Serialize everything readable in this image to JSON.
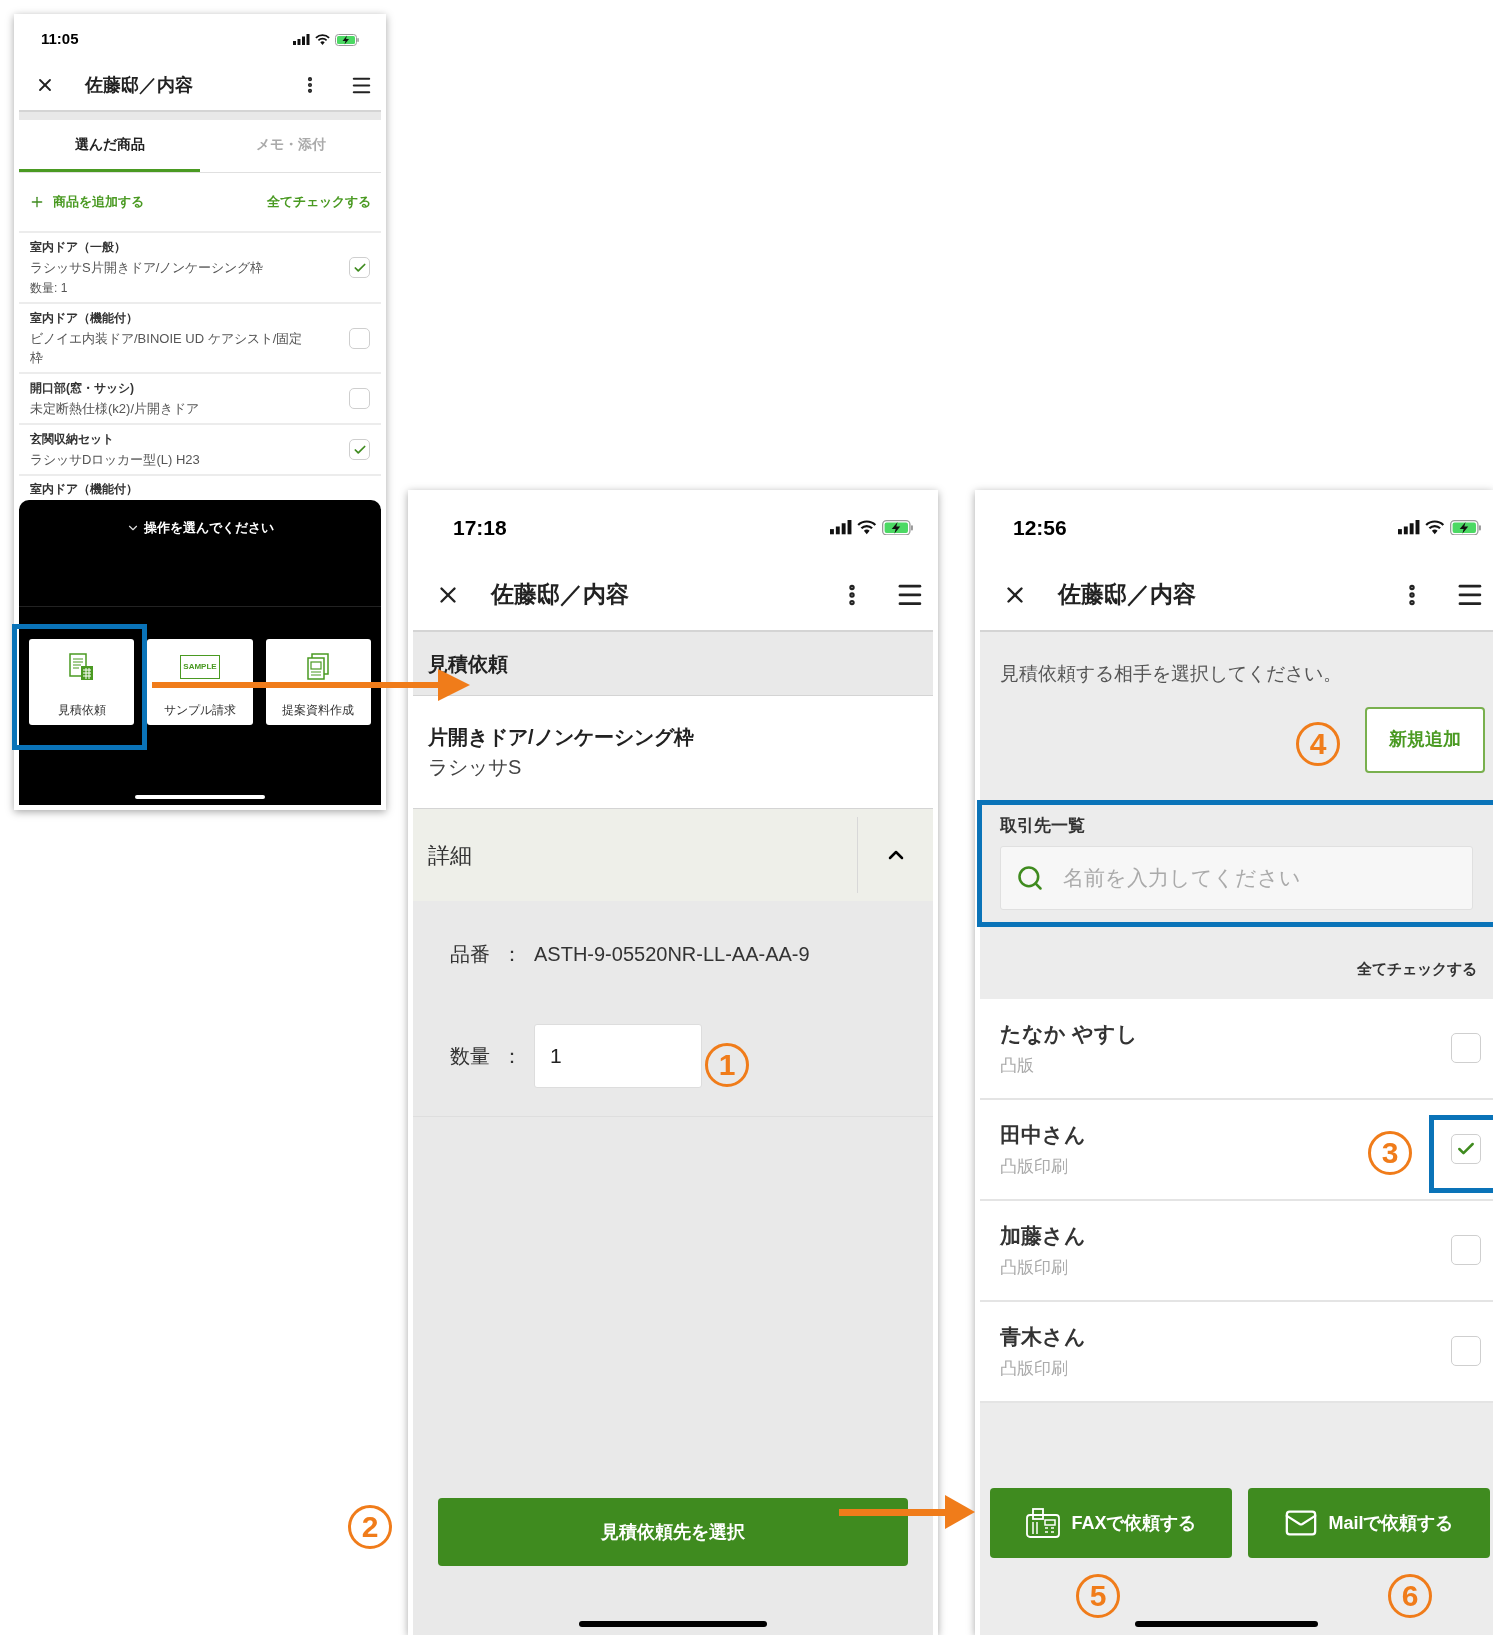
{
  "product_list_screen": {
    "status_time": "11:05",
    "title": "佐藤邸／内容",
    "tabs": [
      {
        "label": "選んだ商品",
        "selected": true
      },
      {
        "label": "メモ・添付",
        "selected": false
      }
    ],
    "add_item": "商品を追加する",
    "check_all": "全てチェックする",
    "items": [
      {
        "category": "室内ドア（一般）",
        "name": "ラシッサS片開きドア/ノンケーシング枠",
        "quantity": "数量: 1",
        "checked": true
      },
      {
        "category": "室内ドア（機能付）",
        "name": "ビノイエ内装ドア/BINOIE UD ケアシスト/固定枠",
        "checked": false
      },
      {
        "category": "開口部(窓・サッシ)",
        "name": "未定断熱仕様(k2)/片開きドア",
        "checked": false
      },
      {
        "category": "玄関収納セット",
        "name": "ラシッサDロッカー型(L) H23",
        "checked": true
      }
    ],
    "partial_item": "室内ドア（機能付）",
    "action_sheet": {
      "title": "操作を選んでください",
      "actions": [
        {
          "kind": "estimate",
          "label": "見積依頼"
        },
        {
          "kind": "sample",
          "label": "サンプル請求",
          "icon_text": "SAMPLE"
        },
        {
          "kind": "proposal",
          "label": "提案資料作成"
        }
      ]
    }
  },
  "request_screen": {
    "status_time": "17:18",
    "title": "佐藤邸／内容",
    "section_title": "見積依頼",
    "product": {
      "name": "片開きドア/ノンケーシング枠",
      "series": "ラシッサS"
    },
    "details": {
      "label": "詳細",
      "expanded": true
    },
    "part_number": {
      "label": "品番",
      "separator": "：",
      "value": "ASTH-9-05520NR-LL-AA-AA-9"
    },
    "quantity": {
      "label": "数量",
      "separator": "：",
      "value": "1"
    },
    "submit_button": "見積依頼先を選択"
  },
  "supplier_screen": {
    "status_time": "12:56",
    "title": "佐藤邸／内容",
    "instruction": "見積依頼する相手を選択してください。",
    "add_button": "新規追加",
    "list_label": "取引先一覧",
    "search": {
      "placeholder": "名前を入力してください"
    },
    "check_all": "全てチェックする",
    "contacts": [
      {
        "name": "たなか やすし",
        "company": "凸版",
        "checked": false
      },
      {
        "name": "田中さん",
        "company": "凸版印刷",
        "checked": true
      },
      {
        "name": "加藤さん",
        "company": "凸版印刷",
        "checked": false
      },
      {
        "name": "青木さん",
        "company": "凸版印刷",
        "checked": false
      }
    ],
    "buttons": [
      {
        "kind": "fax",
        "label": "FAXで依頼する"
      },
      {
        "kind": "mail",
        "label": "Mailで依頼する"
      }
    ]
  },
  "annotations": [
    {
      "label": "1"
    },
    {
      "label": "2"
    },
    {
      "label": "3"
    },
    {
      "label": "4"
    },
    {
      "label": "5"
    },
    {
      "label": "6"
    }
  ]
}
